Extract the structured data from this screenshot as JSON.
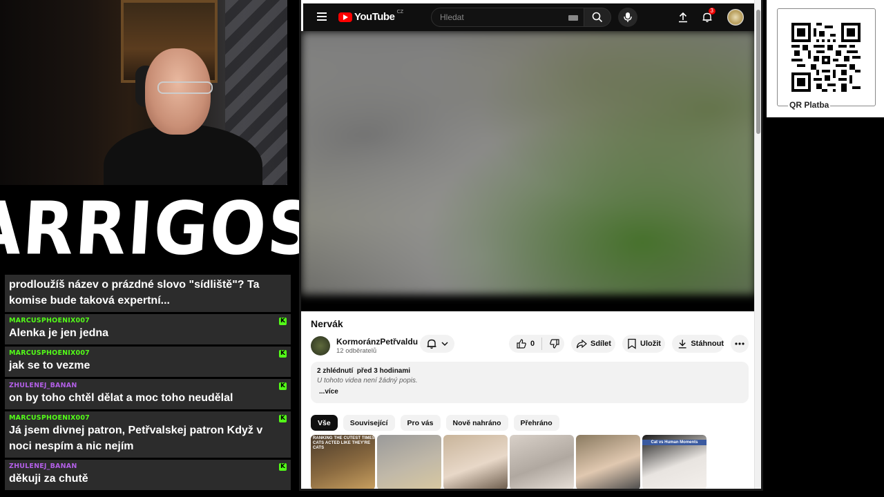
{
  "brand": {
    "name": "ARRIGOS"
  },
  "chat": {
    "messages": [
      {
        "author": "",
        "author_color": "#ffffff",
        "text": "prodloužíš název o prázdné slovo \"sídliště\"? Ta komise bude taková expertní...",
        "badge": false
      },
      {
        "author": "MARCUSPHOENIX007",
        "author_color": "#53fc18",
        "text": "Alenka je jen jedna",
        "badge": true
      },
      {
        "author": "MARCUSPHOENIX007",
        "author_color": "#53fc18",
        "text": "jak se to vezme",
        "badge": true
      },
      {
        "author": "ZHULENEJ_BANAN",
        "author_color": "#b25fe6",
        "text": "on by toho chtěl dělat a moc toho neudělal",
        "badge": true
      },
      {
        "author": "MARCUSPHOENIX007",
        "author_color": "#53fc18",
        "text": "Já jsem divnej patron, Petřvalskej patron Když v noci nespím a nic nejím",
        "badge": true
      },
      {
        "author": "ZHULENEJ_BANAN",
        "author_color": "#b25fe6",
        "text": "děkuji za chutě",
        "badge": true
      }
    ],
    "badge_symbol": "K"
  },
  "youtube": {
    "logo_text": "YouTube",
    "country_code": "CZ",
    "search_placeholder": "Hledat",
    "notification_count": "3",
    "video": {
      "title": "Nervák",
      "channel": "KormoránzPetřvaldu",
      "subscribers": "12 odběratelů",
      "likes": "0",
      "share_label": "Sdílet",
      "save_label": "Uložit",
      "download_label": "Stáhnout",
      "views": "2 zhlédnutí",
      "age": "před 3 hodinami",
      "description": "U tohoto videa není žádný popis.",
      "more_label": "...více"
    },
    "chips": [
      "Vše",
      "Související",
      "Pro vás",
      "Nově nahráno",
      "Přehráno"
    ],
    "thumbnails": [
      {
        "caption_line1": "RANKING THE CUTEST TIMES",
        "caption_line2": "CATS ACTED LIKE THEY'RE CATS",
        "colors": [
          "#4a3a2a",
          "#8a6a40",
          "#c9a060"
        ]
      },
      {
        "caption_line1": "",
        "caption_line2": "",
        "colors": [
          "#9a9a9a",
          "#c0b8a8",
          "#d8c8a0"
        ]
      },
      {
        "caption_line1": "",
        "caption_line2": "",
        "colors": [
          "#c8b49a",
          "#e8d8c8",
          "#6a5a4a"
        ]
      },
      {
        "caption_line1": "",
        "caption_line2": "",
        "colors": [
          "#d8d0c8",
          "#b0a8a0",
          "#e8e0d8"
        ]
      },
      {
        "caption_line1": "",
        "caption_line2": "",
        "colors": [
          "#8a7a60",
          "#e0c8b0",
          "#4a4a4a"
        ]
      },
      {
        "caption_line1": "Cat vs Human Moments",
        "caption_line2": "",
        "colors": [
          "#1a1a1a",
          "#e8e4e0",
          "#f4f0ec"
        ]
      }
    ]
  },
  "qr": {
    "label": "QR Platba"
  },
  "colors": {
    "kick_green": "#53fc18",
    "chat_bg": "#2c2c2c",
    "yt_red": "#ff0000"
  }
}
